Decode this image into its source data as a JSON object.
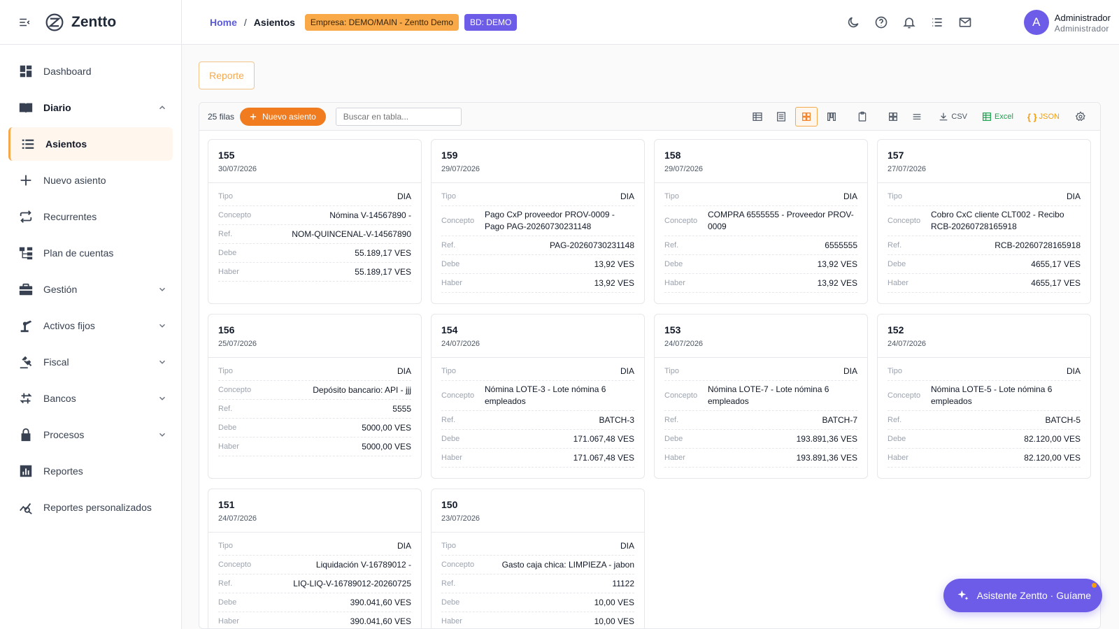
{
  "app": {
    "name": "Zentto"
  },
  "sidebar": {
    "items": [
      {
        "label": "Dashboard",
        "icon": "dashboard-icon"
      },
      {
        "label": "Diario",
        "icon": "book-icon"
      },
      {
        "label": "Asientos",
        "icon": "list-icon"
      },
      {
        "label": "Nuevo asiento",
        "icon": "plus-icon"
      },
      {
        "label": "Recurrentes",
        "icon": "repeat-icon"
      },
      {
        "label": "Plan de cuentas",
        "icon": "tree-icon"
      },
      {
        "label": "Gestión",
        "icon": "briefcase-icon"
      },
      {
        "label": "Activos fijos",
        "icon": "robot-arm-icon"
      },
      {
        "label": "Fiscal",
        "icon": "gavel-icon"
      },
      {
        "label": "Bancos",
        "icon": "transfer-icon"
      },
      {
        "label": "Procesos",
        "icon": "lock-icon"
      },
      {
        "label": "Reportes",
        "icon": "chart-icon"
      },
      {
        "label": "Reportes personalizados",
        "icon": "analytics-icon"
      }
    ]
  },
  "header": {
    "breadcrumb_home": "Home",
    "breadcrumb_sep": "/",
    "breadcrumb_current": "Asientos",
    "empresa_badge": "Empresa: DEMO/MAIN - Zentto Demo",
    "bd_badge": "BD: DEMO",
    "user_initial": "A",
    "user_name": "Administrador",
    "user_role": "Administrador"
  },
  "main": {
    "report_button": "Reporte",
    "rows_count": "25 filas",
    "new_button": "Nuevo asiento",
    "search_placeholder": "Buscar en tabla...",
    "csv_label": "CSV",
    "excel_label": "Excel",
    "json_label": "JSON"
  },
  "labels": {
    "tipo": "Tipo",
    "concepto": "Concepto",
    "ref": "Ref.",
    "debe": "Debe",
    "haber": "Haber"
  },
  "cards": [
    {
      "num": "155",
      "date": "30/07/2026",
      "tipo": "DIA",
      "concepto": "Nómina V-14567890 -",
      "ref": "NOM-QUINCENAL-V-14567890",
      "debe": "55.189,17 VES",
      "haber": "55.189,17 VES"
    },
    {
      "num": "159",
      "date": "29/07/2026",
      "tipo": "DIA",
      "concepto": "Pago CxP proveedor PROV-0009 - Pago PAG-20260730231148",
      "ref": "PAG-20260730231148",
      "debe": "13,92 VES",
      "haber": "13,92 VES"
    },
    {
      "num": "158",
      "date": "29/07/2026",
      "tipo": "DIA",
      "concepto": "COMPRA 6555555 - Proveedor PROV-0009",
      "ref": "6555555",
      "debe": "13,92 VES",
      "haber": "13,92 VES"
    },
    {
      "num": "157",
      "date": "27/07/2026",
      "tipo": "DIA",
      "concepto": "Cobro CxC cliente CLT002 - Recibo RCB-20260728165918",
      "ref": "RCB-20260728165918",
      "debe": "4655,17 VES",
      "haber": "4655,17 VES"
    },
    {
      "num": "156",
      "date": "25/07/2026",
      "tipo": "DIA",
      "concepto": "Depósito bancario: API - jjj",
      "ref": "5555",
      "debe": "5000,00 VES",
      "haber": "5000,00 VES"
    },
    {
      "num": "154",
      "date": "24/07/2026",
      "tipo": "DIA",
      "concepto": "Nómina LOTE-3 - Lote nómina 6 empleados",
      "ref": "BATCH-3",
      "debe": "171.067,48 VES",
      "haber": "171.067,48 VES"
    },
    {
      "num": "153",
      "date": "24/07/2026",
      "tipo": "DIA",
      "concepto": "Nómina LOTE-7 - Lote nómina 6 empleados",
      "ref": "BATCH-7",
      "debe": "193.891,36 VES",
      "haber": "193.891,36 VES"
    },
    {
      "num": "152",
      "date": "24/07/2026",
      "tipo": "DIA",
      "concepto": "Nómina LOTE-5 - Lote nómina 6 empleados",
      "ref": "BATCH-5",
      "debe": "82.120,00 VES",
      "haber": "82.120,00 VES"
    },
    {
      "num": "151",
      "date": "24/07/2026",
      "tipo": "DIA",
      "concepto": "Liquidación V-16789012 -",
      "ref": "LIQ-LIQ-V-16789012-20260725",
      "debe": "390.041,60 VES",
      "haber": "390.041,60 VES"
    },
    {
      "num": "150",
      "date": "23/07/2026",
      "tipo": "DIA",
      "concepto": "Gasto caja chica: LIMPIEZA - jabon",
      "ref": "11122",
      "debe": "10,00 VES",
      "haber": "10,00 VES"
    }
  ],
  "assistant": {
    "label": "Asistente Zentto · Guíame"
  }
}
